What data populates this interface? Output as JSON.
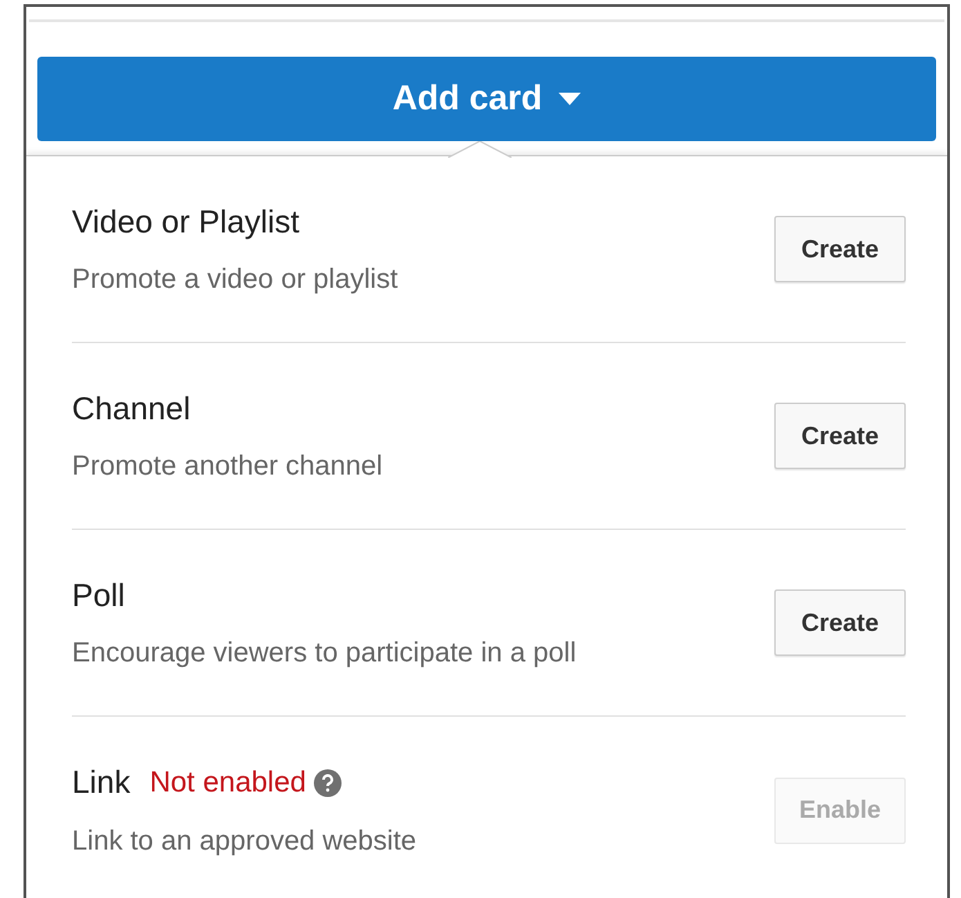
{
  "add_button": {
    "label": "Add card",
    "menu_open": true
  },
  "items": [
    {
      "title": "Video or Playlist",
      "description": "Promote a video or playlist",
      "button": "Create",
      "disabled": false
    },
    {
      "title": "Channel",
      "description": "Promote another channel",
      "button": "Create",
      "disabled": false
    },
    {
      "title": "Poll",
      "description": "Encourage viewers to participate in a poll",
      "button": "Create",
      "disabled": false
    },
    {
      "title": "Link",
      "status": "Not enabled",
      "description": "Link to an approved website",
      "button": "Enable",
      "disabled": true
    }
  ]
}
